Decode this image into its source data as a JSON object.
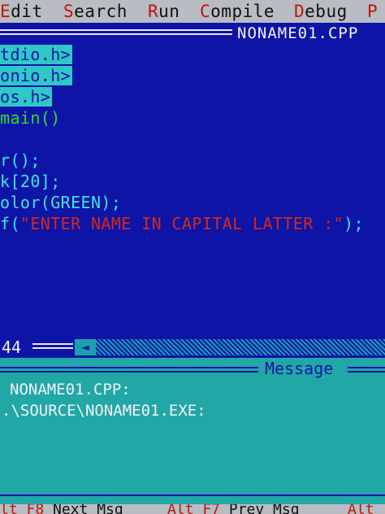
{
  "menubar": {
    "items": [
      {
        "hot": "E",
        "rest": "dit"
      },
      {
        "hot": "S",
        "rest": "earch"
      },
      {
        "hot": "R",
        "rest": "un"
      },
      {
        "hot": "C",
        "rest": "ompile"
      },
      {
        "hot": "D",
        "rest": "ebug"
      },
      {
        "hot": "P",
        "rest": ""
      }
    ]
  },
  "editor": {
    "filename": "NONAME01.CPP",
    "lines": [
      "tdio.h>",
      "onio.h>",
      "os.h>",
      "main()",
      "",
      "r();",
      "k[20];",
      "olor(GREEN);",
      "f(",
      "\"ENTER NAME IN CAPITAL LATTER :\"",
      ");"
    ]
  },
  "status": {
    "line_number": "44",
    "scroll_left_icon": "scroll-left-arrow-icon"
  },
  "message_panel": {
    "title": "Message",
    "lines": [
      "NONAME01.CPP:",
      ".\\SOURCE\\NONAME01.EXE:"
    ]
  },
  "hints": {
    "items": [
      {
        "hot": "lt F8",
        "rest": " Next Msg"
      },
      {
        "hot": "Alt F7",
        "rest": " Prev Msg"
      },
      {
        "hot": "Alt",
        "rest": ""
      }
    ]
  },
  "colors": {
    "editor_bg": "#0d14a6",
    "menu_bg": "#b9bcc2",
    "hotkey": "#c0140c",
    "code": "#3fe6e6",
    "string": "#d2281c",
    "message_bg": "#22a7a7"
  }
}
